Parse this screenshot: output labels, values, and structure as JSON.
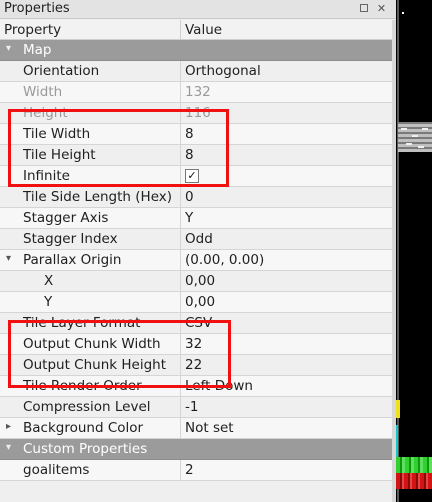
{
  "panel": {
    "title": "Properties",
    "float_icon": "float-icon",
    "close_icon": "close-icon",
    "close_glyph": "✕"
  },
  "header": {
    "property": "Property",
    "value": "Value"
  },
  "rows": [
    {
      "name": "Map",
      "value": "",
      "type": "group",
      "arrow": "▾"
    },
    {
      "name": "Orientation",
      "value": "Orthogonal"
    },
    {
      "name": "Width",
      "value": "132",
      "disabled": true
    },
    {
      "name": "Height",
      "value": "116",
      "disabled": true
    },
    {
      "name": "Tile Width",
      "value": "8"
    },
    {
      "name": "Tile Height",
      "value": "8"
    },
    {
      "name": "Infinite",
      "value": "✓",
      "type": "checkbox"
    },
    {
      "name": "Tile Side Length (Hex)",
      "value": "0"
    },
    {
      "name": "Stagger Axis",
      "value": "Y"
    },
    {
      "name": "Stagger Index",
      "value": "Odd"
    },
    {
      "name": "Parallax Origin",
      "value": "(0.00, 0.00)",
      "arrow": "▾"
    },
    {
      "name": "X",
      "value": "0,00"
    },
    {
      "name": "Y",
      "value": "0,00"
    },
    {
      "name": "Tile Layer Format",
      "value": "CSV"
    },
    {
      "name": "Output Chunk Width",
      "value": "32"
    },
    {
      "name": "Output Chunk Height",
      "value": "22"
    },
    {
      "name": "Tile Render Order",
      "value": "Left Down"
    },
    {
      "name": "Compression Level",
      "value": "-1"
    },
    {
      "name": "Background Color",
      "value": "Not set",
      "arrow": "▸"
    },
    {
      "name": "Custom Properties",
      "value": "",
      "type": "group",
      "arrow": "▾"
    },
    {
      "name": "goalitems",
      "value": "2"
    }
  ],
  "colors": {
    "highlight": "#f01010",
    "group_row": "#9b9b9b",
    "panel_bg": "#efefef"
  }
}
